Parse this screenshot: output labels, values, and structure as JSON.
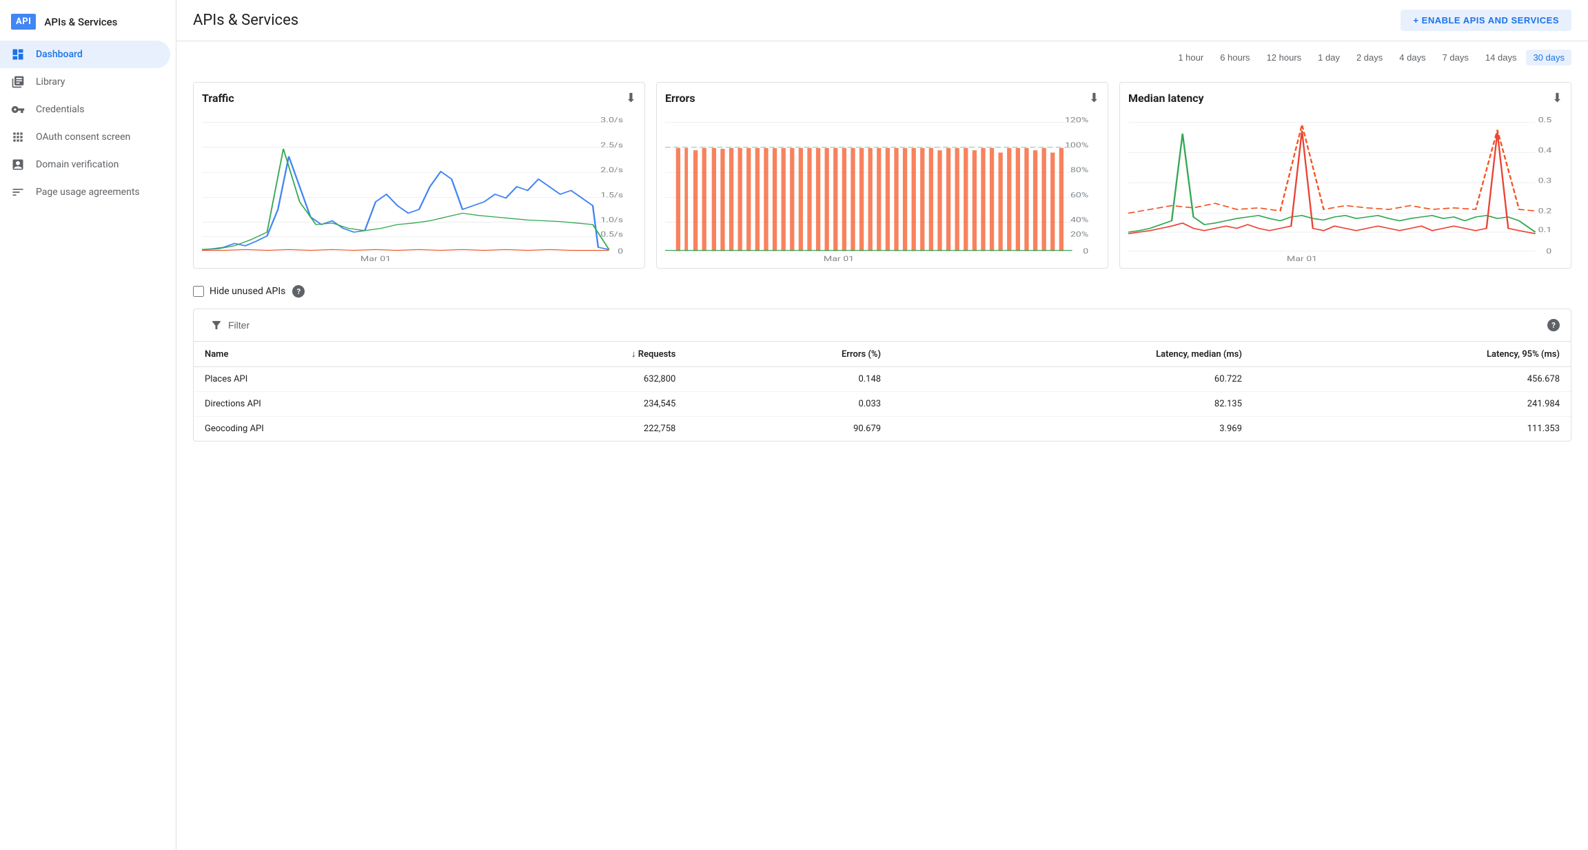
{
  "sidebar": {
    "logo": "API",
    "title": "APIs & Services",
    "items": [
      {
        "id": "dashboard",
        "label": "Dashboard",
        "icon": "dashboard",
        "active": true
      },
      {
        "id": "library",
        "label": "Library",
        "icon": "library",
        "active": false
      },
      {
        "id": "credentials",
        "label": "Credentials",
        "icon": "credentials",
        "active": false
      },
      {
        "id": "oauth",
        "label": "OAuth consent screen",
        "icon": "oauth",
        "active": false
      },
      {
        "id": "domain",
        "label": "Domain verification",
        "icon": "domain",
        "active": false
      },
      {
        "id": "page-usage",
        "label": "Page usage agreements",
        "icon": "page-usage",
        "active": false
      }
    ]
  },
  "header": {
    "title": "APIs & Services",
    "enable_btn": "+ ENABLE APIS AND SERVICES"
  },
  "time_range": {
    "options": [
      "1 hour",
      "6 hours",
      "12 hours",
      "1 day",
      "2 days",
      "4 days",
      "7 days",
      "14 days",
      "30 days"
    ],
    "active": "30 days"
  },
  "charts": [
    {
      "id": "traffic",
      "title": "Traffic",
      "x_label": "Mar 01"
    },
    {
      "id": "errors",
      "title": "Errors",
      "x_label": "Mar 01"
    },
    {
      "id": "latency",
      "title": "Median latency",
      "x_label": "Mar 01"
    }
  ],
  "filter": {
    "label": "Hide unused APIs",
    "checked": false
  },
  "table": {
    "filter_label": "Filter",
    "help_label": "?",
    "columns": [
      "Name",
      "↓ Requests",
      "Errors (%)",
      "Latency, median (ms)",
      "Latency, 95% (ms)"
    ],
    "rows": [
      {
        "name": "Places API",
        "requests": "632,800",
        "errors": "0.148",
        "latency_median": "60.722",
        "latency_95": "456.678"
      },
      {
        "name": "Directions API",
        "requests": "234,545",
        "errors": "0.033",
        "latency_median": "82.135",
        "latency_95": "241.984"
      },
      {
        "name": "Geocoding API",
        "requests": "222,758",
        "errors": "90.679",
        "latency_median": "3.969",
        "latency_95": "111.353"
      }
    ]
  }
}
